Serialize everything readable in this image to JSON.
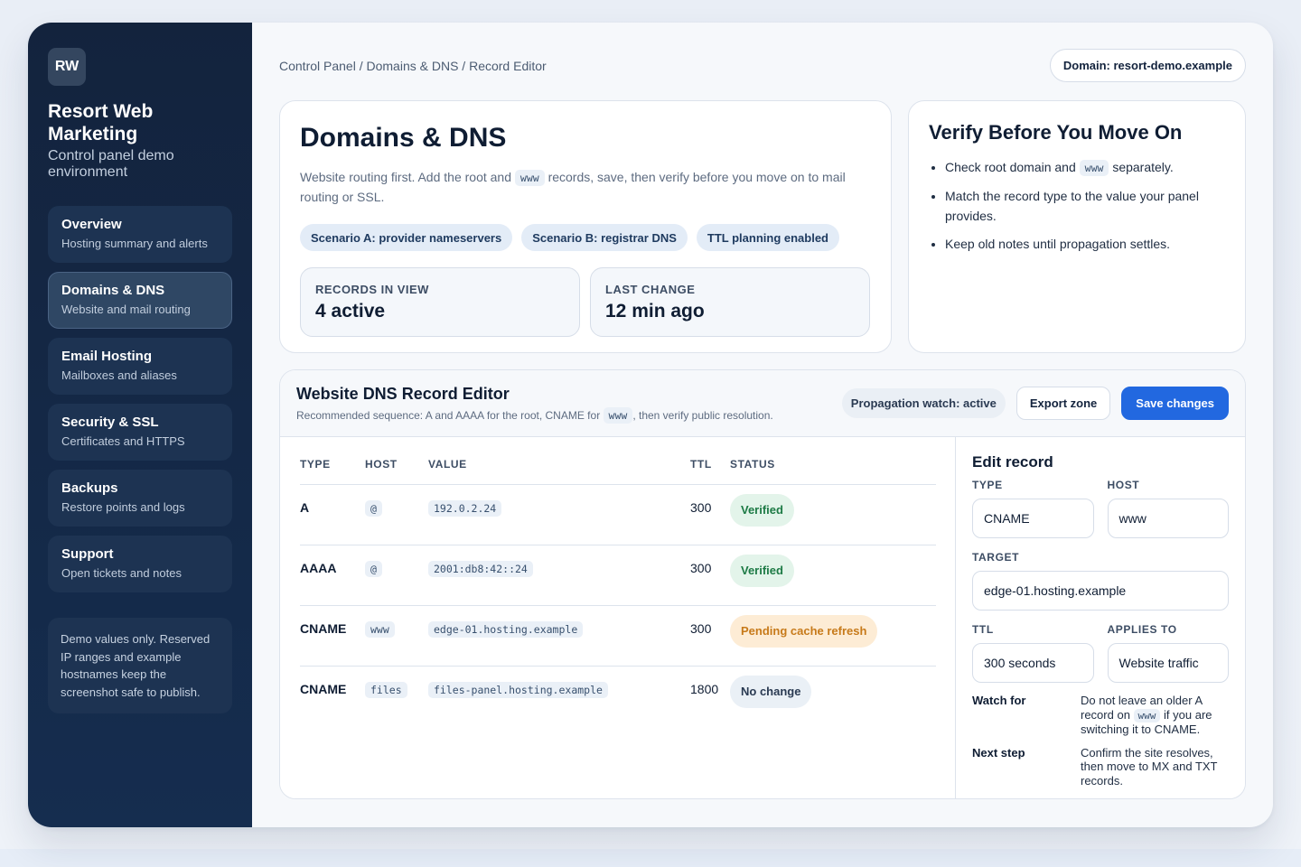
{
  "sidebar": {
    "logo": "RW",
    "brand_title": "Resort Web Marketing",
    "brand_sub": "Control panel demo environment",
    "items": [
      {
        "label": "Overview",
        "desc": "Hosting summary and alerts"
      },
      {
        "label": "Domains & DNS",
        "desc": "Website and mail routing"
      },
      {
        "label": "Email Hosting",
        "desc": "Mailboxes and aliases"
      },
      {
        "label": "Security & SSL",
        "desc": "Certificates and HTTPS"
      },
      {
        "label": "Backups",
        "desc": "Restore points and logs"
      },
      {
        "label": "Support",
        "desc": "Open tickets and notes"
      }
    ],
    "note": "Demo values only. Reserved IP ranges and example hostnames keep the screenshot safe to publish."
  },
  "header": {
    "breadcrumb": "Control Panel / Domains & DNS / Record Editor",
    "domain_pill": "Domain: resort-demo.example"
  },
  "hero": {
    "title": "Domains & DNS",
    "desc_before": "Website routing first. Add the root and",
    "desc_code": "www",
    "desc_after": "records, save, then verify before you move on to mail routing or SSL.",
    "chips": [
      "Scenario A: provider nameservers",
      "Scenario B: registrar DNS",
      "TTL planning enabled"
    ],
    "stats": [
      {
        "label": "RECORDS IN VIEW",
        "value": "4 active"
      },
      {
        "label": "LAST CHANGE",
        "value": "12 min ago"
      }
    ]
  },
  "verify": {
    "title": "Verify Before You Move On",
    "item1_before": "Check root domain and",
    "item1_code": "www",
    "item1_after": "separately.",
    "item2": "Match the record type to the value your panel provides.",
    "item3": "Keep old notes until propagation settles."
  },
  "editor": {
    "title": "Website DNS Record Editor",
    "sub_before": "Recommended sequence: A and AAAA for the root, CNAME for",
    "sub_code": "www",
    "sub_after": ", then verify public resolution.",
    "watch": "Propagation watch: active",
    "export_label": "Export zone",
    "save_label": "Save changes",
    "columns": [
      "TYPE",
      "HOST",
      "VALUE",
      "TTL",
      "STATUS"
    ],
    "rows": [
      {
        "type": "A",
        "host": "@",
        "value": "192.0.2.24",
        "ttl": "300",
        "status": "Verified"
      },
      {
        "type": "AAAA",
        "host": "@",
        "value": "2001:db8:42::24",
        "ttl": "300",
        "status": "Verified"
      },
      {
        "type": "CNAME",
        "host": "www",
        "value": "edge-01.hosting.example",
        "ttl": "300",
        "status": "Pending cache refresh"
      },
      {
        "type": "CNAME",
        "host": "files",
        "value": "files-panel.hosting.example",
        "ttl": "1800",
        "status": "No change"
      }
    ]
  },
  "edit_record": {
    "title": "Edit record",
    "type_label": "TYPE",
    "type_value": "CNAME",
    "host_label": "HOST",
    "host_value": "www",
    "target_label": "TARGET",
    "target_value": "edge-01.hosting.example",
    "ttl_label": "TTL",
    "ttl_value": "300 seconds",
    "applies_label": "APPLIES TO",
    "applies_value": "Website traffic",
    "watch_key": "Watch for",
    "watch_before": "Do not leave an older A record on",
    "watch_code": "www",
    "watch_after": "if you are switching it to CNAME.",
    "next_key": "Next step",
    "next_val": "Confirm the site resolves, then move to MX and TXT records."
  },
  "colors": {
    "sidebar_bg": "#13233d",
    "accent": "#2268e0",
    "verified": "#1d7a45",
    "pending": "#c77a1a"
  }
}
